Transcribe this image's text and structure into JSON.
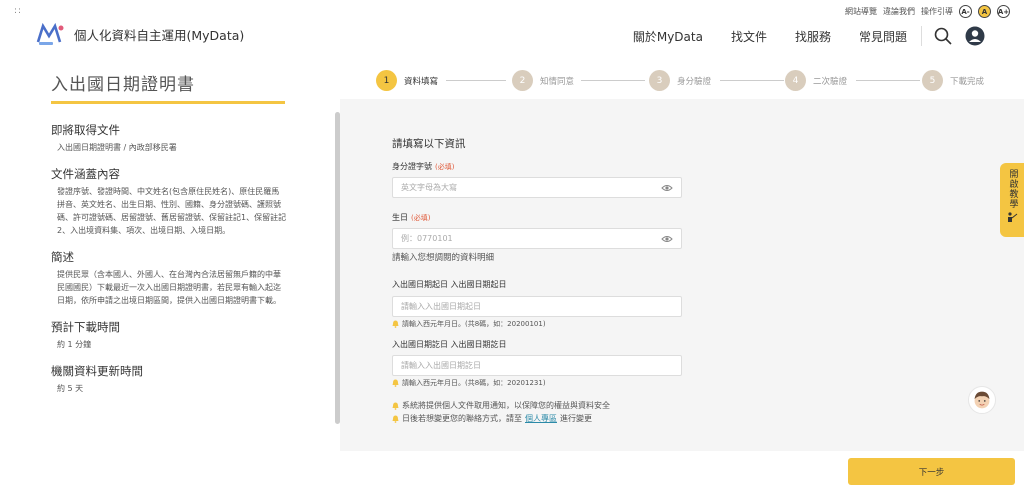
{
  "utility": {
    "dots": "::",
    "links": [
      "網站導覽",
      "違論我們",
      "操作引導"
    ],
    "font_sizes": [
      "A-",
      "A",
      "A+"
    ],
    "active_font": 1
  },
  "header": {
    "brand": "個人化資料自主運用(MyData)",
    "nav": [
      "關於MyData",
      "找文件",
      "找服務",
      "常見問題"
    ]
  },
  "left": {
    "page_title": "入出國日期證明書",
    "sections": [
      {
        "title": "即將取得文件",
        "body": "入出國日期證明書 / 內政部移民署"
      },
      {
        "title": "文件涵蓋內容",
        "body": "發證序號、發證時間、中文姓名(包含原住民姓名)、原住民羅馬拼音、英文姓名、出生日期、性別、國籍、身分證號碼、護照號碼、許可證號碼、居留證號、舊居留證號、保留註記1、保留註記2、入出境資料集、項次、出境日期、入境日期。"
      },
      {
        "title": "簡述",
        "body": "提供民眾（含本國人、外國人、在台灣內合法居留無戶籍的中華民國國民）下載最近一次入出國日期證明書，若民眾有輸入起迄日期，依所申請之出境日期區間，提供入出國日期證明書下載。"
      },
      {
        "title": "預計下載時間",
        "body": "約 1 分鐘"
      },
      {
        "title": "機關資料更新時間",
        "body": "約 5 天"
      }
    ]
  },
  "steps": [
    {
      "num": "1",
      "label": "資料填寫"
    },
    {
      "num": "2",
      "label": "知情同意"
    },
    {
      "num": "3",
      "label": "身分驗證"
    },
    {
      "num": "4",
      "label": "二次驗證"
    },
    {
      "num": "5",
      "label": "下載完成"
    }
  ],
  "form": {
    "title": "請填寫以下資訊",
    "id_label": "身分證字號",
    "required": "(必填)",
    "id_placeholder": "英文字母為大寫",
    "dob_label": "生日",
    "dob_placeholder": "例：0770101",
    "help_text": "請輸入您想調閱的資料明細",
    "start_label": "入出國日期起日 入出國日期起日",
    "start_placeholder": "請輸入入出國日期起日",
    "start_hint": "請輸入西元年月日。(共8碼，如：20200101)",
    "end_label": "入出國日期訖日 入出國日期訖日",
    "end_placeholder": "請輸入入出國日期訖日",
    "end_hint": "請輸入西元年月日。(共8碼，如：20201231)",
    "notice1": "系統將提供個人文件取用通知，以保障您的權益與資料安全",
    "notice2_pre": "日後若想變更您的聯絡方式，請至",
    "notice2_link": "個人專區",
    "notice2_post": "進行變更"
  },
  "side_tab": "開啟教學",
  "next_button": "下一步",
  "colors": {
    "accent": "#f4c542",
    "required": "#e05a3a",
    "link": "#2b8aa8"
  }
}
